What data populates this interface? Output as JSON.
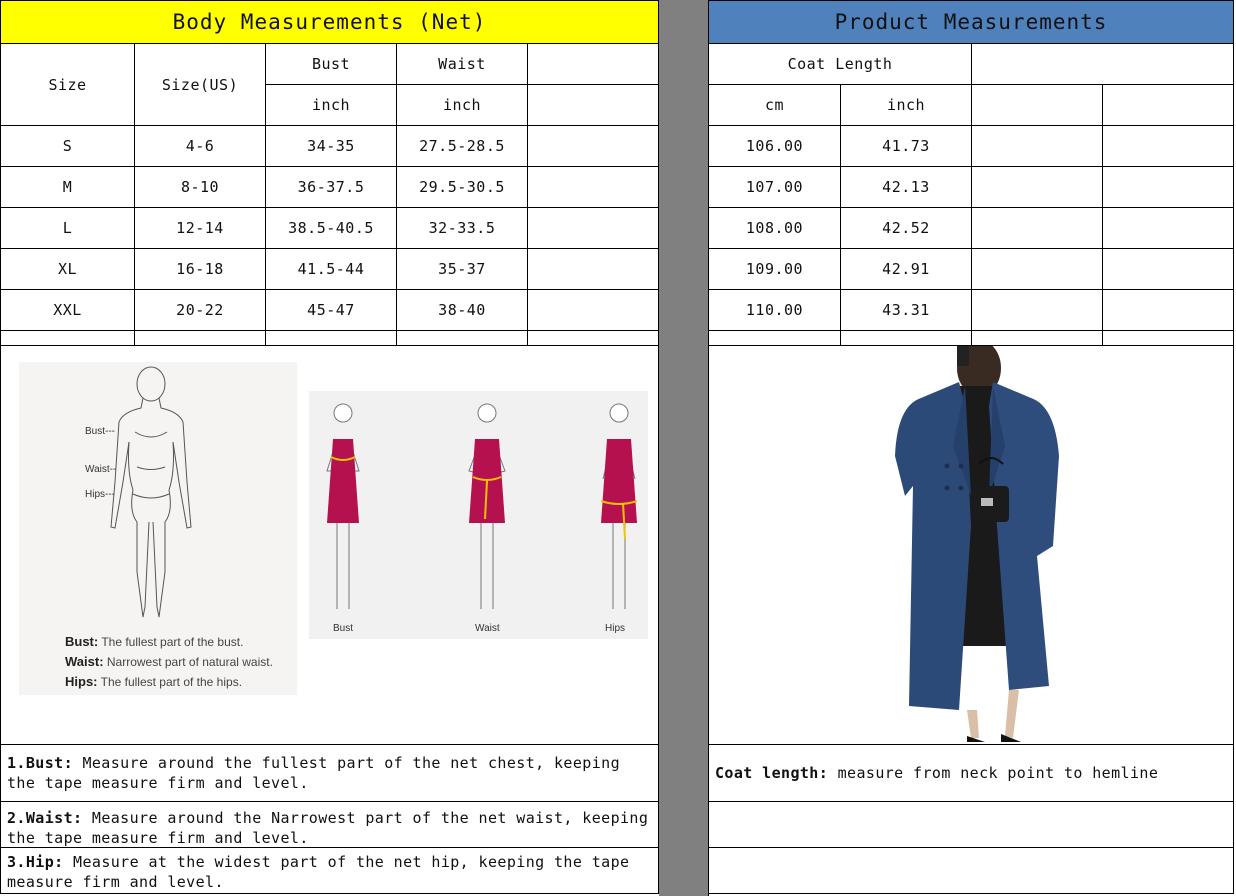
{
  "left_title": "Body Measurements (Net)",
  "right_title": "Product Measurements",
  "body_headers": {
    "size": "Size",
    "size_us": "Size(US)",
    "bust": "Bust",
    "waist": "Waist",
    "bust_unit": "inch",
    "waist_unit": "inch"
  },
  "product_headers": {
    "coat_length": "Coat Length",
    "cm": "cm",
    "inch": "inch"
  },
  "rows": [
    {
      "size": "S",
      "size_us": "4-6",
      "bust": "34-35",
      "waist": "27.5-28.5",
      "cm": "106.00",
      "inch": "41.73"
    },
    {
      "size": "M",
      "size_us": "8-10",
      "bust": "36-37.5",
      "waist": "29.5-30.5",
      "cm": "107.00",
      "inch": "42.13"
    },
    {
      "size": "L",
      "size_us": "12-14",
      "bust": "38.5-40.5",
      "waist": "32-33.5",
      "cm": "108.00",
      "inch": "42.52"
    },
    {
      "size": "XL",
      "size_us": "16-18",
      "bust": "41.5-44",
      "waist": "35-37",
      "cm": "109.00",
      "inch": "42.91"
    },
    {
      "size": "XXL",
      "size_us": "20-22",
      "bust": "45-47",
      "waist": "38-40",
      "cm": "110.00",
      "inch": "43.31"
    }
  ],
  "figure": {
    "bust_mark": "Bust---",
    "waist_mark": "Waist--",
    "hips_mark": "Hips---",
    "captions": [
      {
        "term": "Bust:",
        "text": " The fullest part of the bust."
      },
      {
        "term": "Waist:",
        "text": " Narrowest part of natural waist."
      },
      {
        "term": "Hips:",
        "text": " The fullest part of the hips."
      }
    ],
    "dress_labels": [
      "Bust",
      "Waist",
      "Hips"
    ]
  },
  "notes": [
    {
      "term": "1.Bust:",
      "text": "  Measure around the fullest part of the net chest, keeping the tape  measure firm and level."
    },
    {
      "term": "2.Waist:",
      "text": " Measure around the Narrowest part of the net waist, keeping the tape  measure firm and level."
    },
    {
      "term": "3.Hip:",
      "text": " Measure at the widest part of the net hip, keeping the tape measure firm and level."
    }
  ],
  "coat_note": {
    "term": "Coat length:",
    "text": " measure from neck point to hemline"
  },
  "colors": {
    "title_yellow": "#ffff00",
    "title_blue": "#4f81bd",
    "gap_gray": "#808080",
    "dress": "#b5114f",
    "coat": "#2c4a78"
  }
}
